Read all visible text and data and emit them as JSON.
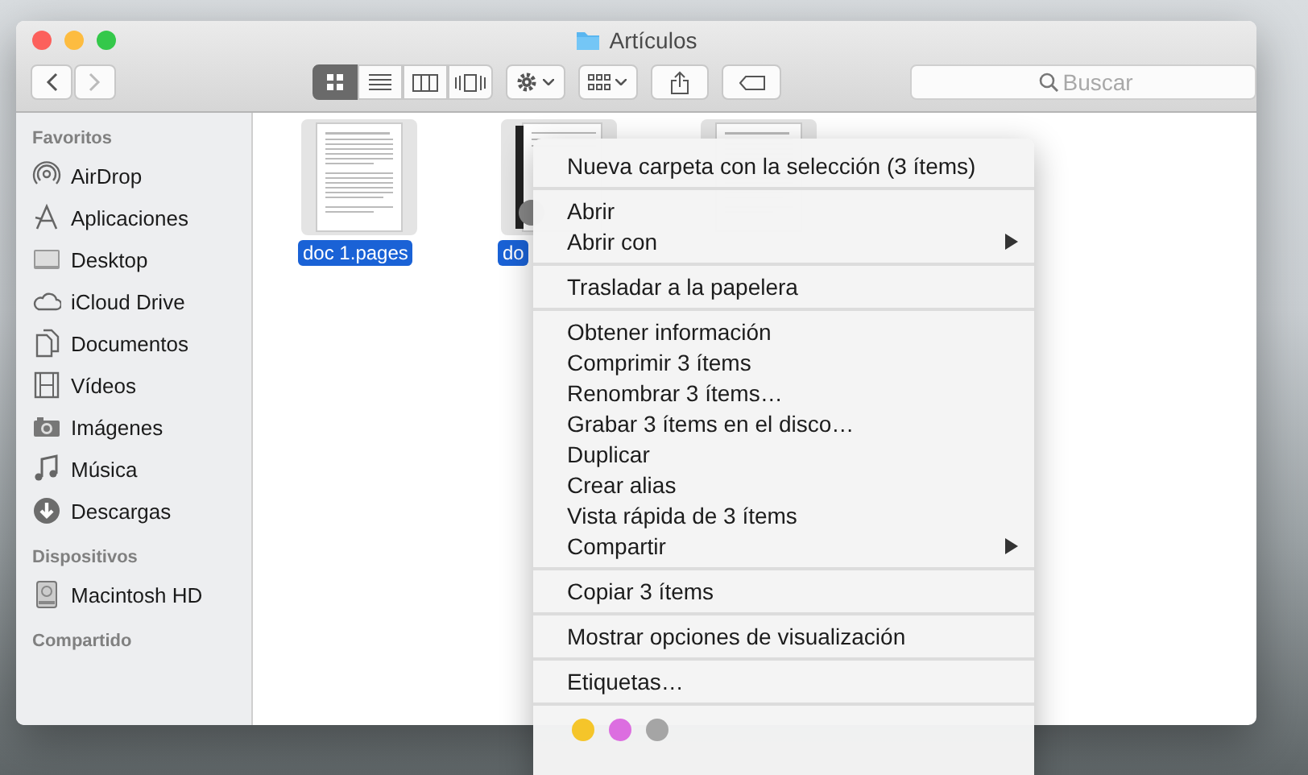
{
  "window": {
    "title": "Artículos"
  },
  "toolbar": {
    "views": [
      {
        "kind": "icon",
        "selected": true
      },
      {
        "kind": "list",
        "selected": false
      },
      {
        "kind": "columns",
        "selected": false
      },
      {
        "kind": "coverflow",
        "selected": false
      }
    ],
    "search": {
      "placeholder": "Buscar"
    }
  },
  "sidebar": {
    "sections": [
      {
        "title": "Favoritos",
        "items": [
          {
            "label": "AirDrop",
            "kind": "airdrop"
          },
          {
            "label": "Aplicaciones",
            "kind": "apps"
          },
          {
            "label": "Desktop",
            "kind": "desktop"
          },
          {
            "label": "iCloud Drive",
            "kind": "cloud"
          },
          {
            "label": "Documentos",
            "kind": "docs"
          },
          {
            "label": "Vídeos",
            "kind": "film"
          },
          {
            "label": "Imágenes",
            "kind": "camera"
          },
          {
            "label": "Música",
            "kind": "music"
          },
          {
            "label": "Descargas",
            "kind": "download"
          }
        ]
      },
      {
        "title": "Dispositivos",
        "items": [
          {
            "label": "Macintosh HD",
            "kind": "disk"
          }
        ]
      },
      {
        "title": "Compartido"
      }
    ]
  },
  "files": [
    {
      "name": "doc 1.pages",
      "kind": "document",
      "selected": true
    },
    {
      "name": "do",
      "kind": "notebook",
      "selected": true
    },
    {
      "kind": "document",
      "selected": true
    }
  ],
  "context_menu": {
    "sections": [
      [
        {
          "label": "Nueva carpeta con la selección (3 ítems)",
          "submenu": false
        }
      ],
      [
        {
          "label": "Abrir",
          "submenu": false
        },
        {
          "label": "Abrir con",
          "submenu": true
        }
      ],
      [
        {
          "label": "Trasladar a la papelera",
          "submenu": false
        }
      ],
      [
        {
          "label": "Obtener información",
          "submenu": false
        },
        {
          "label": "Comprimir 3 ítems",
          "submenu": false
        },
        {
          "label": "Renombrar 3 ítems…",
          "submenu": false
        },
        {
          "label": "Grabar 3 ítems en el disco…",
          "submenu": false
        },
        {
          "label": "Duplicar",
          "submenu": false
        },
        {
          "label": "Crear alias",
          "submenu": false
        },
        {
          "label": "Vista rápida de 3 ítems",
          "submenu": false
        },
        {
          "label": "Compartir",
          "submenu": true
        }
      ],
      [
        {
          "label": "Copiar 3 ítems",
          "submenu": false
        }
      ],
      [
        {
          "label": "Mostrar opciones de visualización",
          "submenu": false
        }
      ],
      [
        {
          "label": "Etiquetas…",
          "submenu": false
        }
      ]
    ],
    "tags": [
      {
        "color": "#f5c52a"
      },
      {
        "color": "#dc6ee0"
      },
      {
        "color": "#a5a5a5"
      }
    ]
  }
}
